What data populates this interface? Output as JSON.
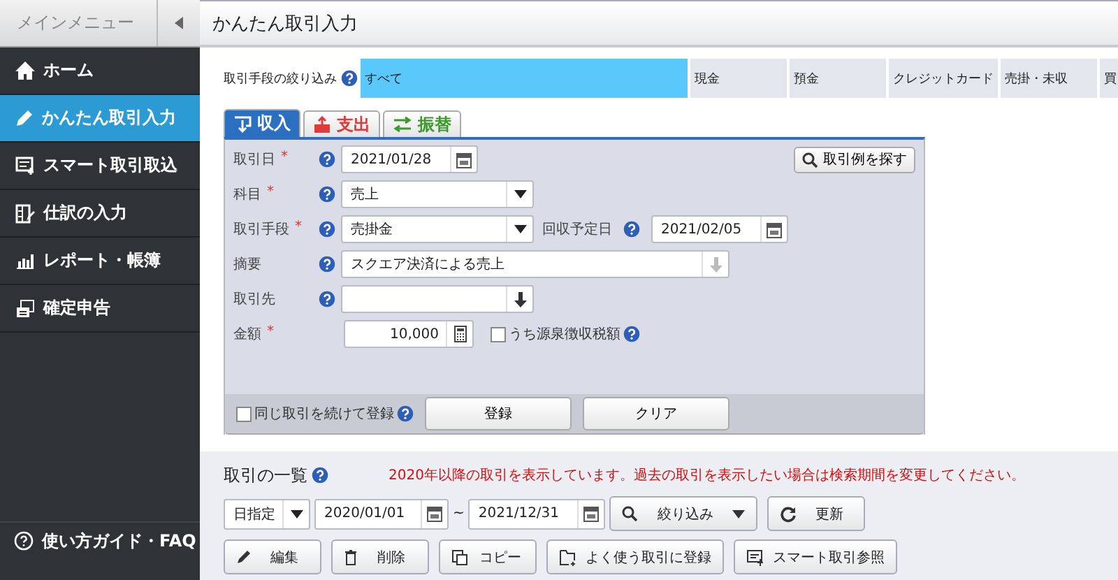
{
  "sidebar": {
    "title": "メインメニュー",
    "items": [
      {
        "label": "ホーム",
        "selected": false
      },
      {
        "label": "かんたん取引入力",
        "selected": true
      },
      {
        "label": "スマート取引取込",
        "selected": false
      },
      {
        "label": "仕訳の入力",
        "selected": false
      },
      {
        "label": "レポート・帳簿",
        "selected": false
      },
      {
        "label": "確定申告",
        "selected": false
      }
    ],
    "footer_link": "使い方ガイド・FAQ"
  },
  "page_title": "かんたん取引入力",
  "filter": {
    "label": "取引手段の絞り込み",
    "options": [
      {
        "label": "すべて",
        "selected": true
      },
      {
        "label": "現金",
        "selected": false
      },
      {
        "label": "預金",
        "selected": false
      },
      {
        "label": "クレジットカード",
        "selected": false
      },
      {
        "label": "売掛・未収",
        "selected": false
      },
      {
        "label": "買",
        "selected": false
      }
    ]
  },
  "form": {
    "tabs": [
      {
        "label": "収入",
        "selected": true,
        "color": "#2a6fc0"
      },
      {
        "label": "支出",
        "selected": false,
        "color": "#e03a3a"
      },
      {
        "label": "振替",
        "selected": false,
        "color": "#3a9a2a"
      }
    ],
    "search_examples_button": "取引例を探す",
    "rows": [
      {
        "kind": "date",
        "label": "取引日",
        "required_mark": "*",
        "value": "2021/01/28"
      },
      {
        "kind": "select",
        "label": "科目",
        "required_mark": "*",
        "value": "売上"
      },
      {
        "kind": "select",
        "label": "取引手段",
        "required_mark": "*",
        "value": "売掛金",
        "extra": {
          "label": "回収予定日",
          "value": "2021/02/05"
        }
      },
      {
        "kind": "text",
        "label": "摘要",
        "value": "スクエア決済による売上"
      },
      {
        "kind": "combo",
        "label": "取引先",
        "value": ""
      },
      {
        "kind": "amount",
        "label": "金額",
        "required_mark": "*",
        "value": "10,000",
        "checkbox": {
          "label": "うち源泉徴収税額",
          "checked": false
        }
      }
    ],
    "repeat_checkbox": {
      "label": "同じ取引を続けて登録",
      "checked": false
    },
    "buttons": [
      "登録",
      "クリア"
    ]
  },
  "list": {
    "title": "取引の一覧",
    "notice": "2020年以降の取引を表示しています。過去の取引を表示したい場合は検索期間を変更してください。",
    "period_select": "日指定",
    "from": "2020/01/01",
    "separator": "~",
    "to": "2021/12/31",
    "filter_button": "絞り込み",
    "refresh_button": "更新",
    "actions": [
      "編集",
      "削除",
      "コピー",
      "よく使う取引に登録",
      "スマート取引参照"
    ]
  }
}
